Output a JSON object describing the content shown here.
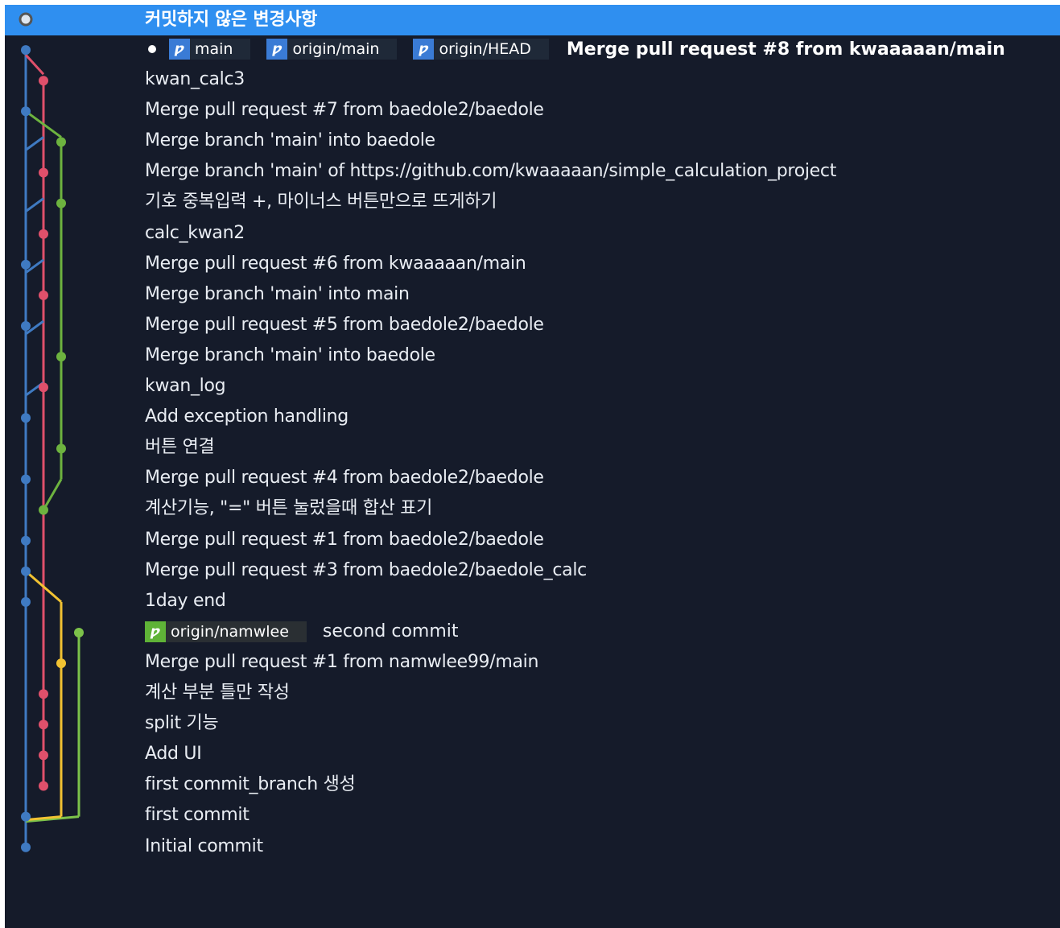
{
  "uncommitted": {
    "label": "커밋하지 않은 변경사항"
  },
  "head": {
    "marker": "current-head",
    "branches": [
      {
        "name": "main",
        "kind": "local"
      },
      {
        "name": "origin/main",
        "kind": "remote"
      },
      {
        "name": "origin/HEAD",
        "kind": "remote"
      }
    ],
    "message": "Merge pull request #8 from kwaaaaan/main"
  },
  "commits": [
    {
      "message": "kwan_calc3"
    },
    {
      "message": "Merge pull request #7 from baedole2/baedole"
    },
    {
      "message": "Merge branch 'main' into baedole"
    },
    {
      "message": "Merge branch 'main' of https://github.com/kwaaaaan/simple_calculation_project"
    },
    {
      "message": "기호 중복입력 +,  마이너스 버튼만으로 뜨게하기"
    },
    {
      "message": "calc_kwan2"
    },
    {
      "message": "Merge pull request #6 from kwaaaaan/main"
    },
    {
      "message": "Merge branch 'main' into main"
    },
    {
      "message": "Merge pull request #5 from baedole2/baedole"
    },
    {
      "message": "Merge branch 'main' into baedole"
    },
    {
      "message": "kwan_log"
    },
    {
      "message": "Add exception handling"
    },
    {
      "message": "버튼 연결"
    },
    {
      "message": "Merge pull request #4 from baedole2/baedole"
    },
    {
      "message": "계산기능, \"=\" 버튼 눌렀을때 합산 표기"
    },
    {
      "message": "Merge pull request #1 from baedole2/baedole"
    },
    {
      "message": "Merge pull request #3 from baedole2/baedole_calc"
    },
    {
      "message": "1day end"
    },
    {
      "message": "second commit",
      "branch": "origin/namwlee"
    },
    {
      "message": "Merge pull request #1 from namwlee99/main"
    },
    {
      "message": "계산 부분 틀만 작성"
    },
    {
      "message": "split 기능"
    },
    {
      "message": "Add UI"
    },
    {
      "message": "first commit_branch 생성"
    },
    {
      "message": "first commit"
    },
    {
      "message": "Initial commit"
    }
  ],
  "colors": {
    "background": "#151b2a",
    "selected": "#2f8ff0",
    "lane_blue": "#3f7ac2",
    "lane_red": "#e0506b",
    "lane_green": "#6db33f",
    "lane_yellow": "#f1c232",
    "lane_lightgreen": "#7cc24a"
  }
}
